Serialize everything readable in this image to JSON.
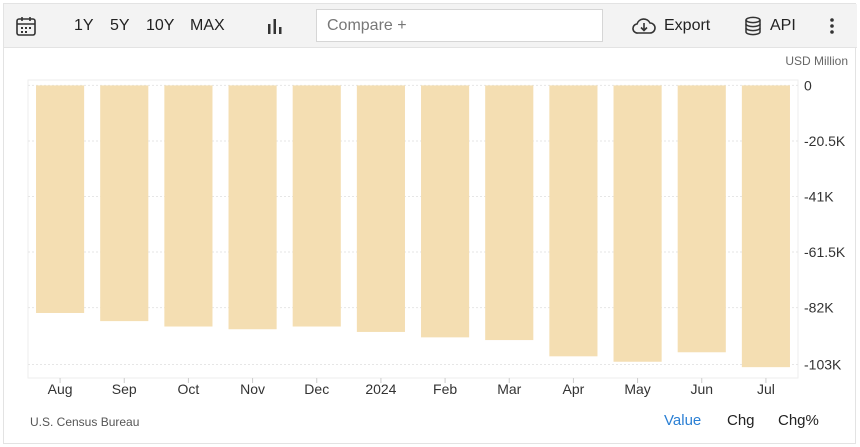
{
  "toolbar": {
    "ranges": [
      "1Y",
      "5Y",
      "10Y",
      "MAX"
    ],
    "compare_placeholder": "Compare +",
    "export_label": "Export",
    "api_label": "API"
  },
  "chart_data": {
    "type": "bar",
    "unit_label": "USD Million",
    "categories": [
      "Aug",
      "Sep",
      "Oct",
      "Nov",
      "Dec",
      "2024",
      "Feb",
      "Mar",
      "Apr",
      "May",
      "Jun",
      "Jul"
    ],
    "values": [
      -84,
      -87,
      -89,
      -90,
      -89,
      -91,
      -93,
      -94,
      -100,
      -102,
      -98.5,
      -104
    ],
    "ylim": [
      -108,
      2
    ],
    "yticks": [
      0,
      -20.5,
      -41,
      -61.5,
      -82,
      -103
    ],
    "ytick_labels": [
      "0",
      "-20.5K",
      "-41K",
      "-61.5K",
      "-82K",
      "-103K"
    ],
    "bar_color": "#f4deb2",
    "grid": true
  },
  "footer": {
    "source": "U.S. Census Bureau",
    "modes": [
      "Value",
      "Chg",
      "Chg%"
    ],
    "active_mode": "Value",
    "active_color": "#2a7fd4"
  }
}
